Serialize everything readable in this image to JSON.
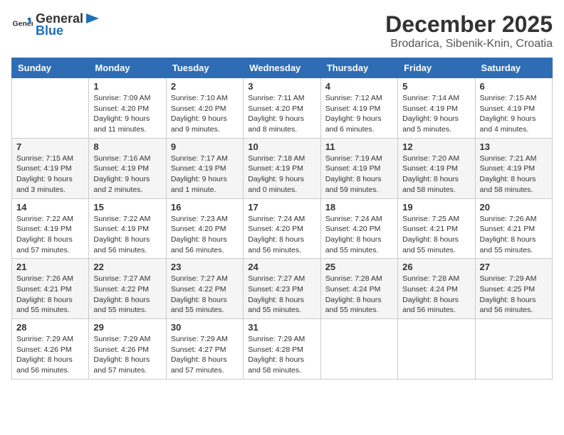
{
  "header": {
    "logo_general": "General",
    "logo_blue": "Blue",
    "month_title": "December 2025",
    "location": "Brodarica, Sibenik-Knin, Croatia"
  },
  "columns": [
    "Sunday",
    "Monday",
    "Tuesday",
    "Wednesday",
    "Thursday",
    "Friday",
    "Saturday"
  ],
  "weeks": [
    [
      {
        "day": "",
        "info": ""
      },
      {
        "day": "1",
        "info": "Sunrise: 7:09 AM\nSunset: 4:20 PM\nDaylight: 9 hours\nand 11 minutes."
      },
      {
        "day": "2",
        "info": "Sunrise: 7:10 AM\nSunset: 4:20 PM\nDaylight: 9 hours\nand 9 minutes."
      },
      {
        "day": "3",
        "info": "Sunrise: 7:11 AM\nSunset: 4:20 PM\nDaylight: 9 hours\nand 8 minutes."
      },
      {
        "day": "4",
        "info": "Sunrise: 7:12 AM\nSunset: 4:19 PM\nDaylight: 9 hours\nand 6 minutes."
      },
      {
        "day": "5",
        "info": "Sunrise: 7:14 AM\nSunset: 4:19 PM\nDaylight: 9 hours\nand 5 minutes."
      },
      {
        "day": "6",
        "info": "Sunrise: 7:15 AM\nSunset: 4:19 PM\nDaylight: 9 hours\nand 4 minutes."
      }
    ],
    [
      {
        "day": "7",
        "info": "Sunrise: 7:15 AM\nSunset: 4:19 PM\nDaylight: 9 hours\nand 3 minutes."
      },
      {
        "day": "8",
        "info": "Sunrise: 7:16 AM\nSunset: 4:19 PM\nDaylight: 9 hours\nand 2 minutes."
      },
      {
        "day": "9",
        "info": "Sunrise: 7:17 AM\nSunset: 4:19 PM\nDaylight: 9 hours\nand 1 minute."
      },
      {
        "day": "10",
        "info": "Sunrise: 7:18 AM\nSunset: 4:19 PM\nDaylight: 9 hours\nand 0 minutes."
      },
      {
        "day": "11",
        "info": "Sunrise: 7:19 AM\nSunset: 4:19 PM\nDaylight: 8 hours\nand 59 minutes."
      },
      {
        "day": "12",
        "info": "Sunrise: 7:20 AM\nSunset: 4:19 PM\nDaylight: 8 hours\nand 58 minutes."
      },
      {
        "day": "13",
        "info": "Sunrise: 7:21 AM\nSunset: 4:19 PM\nDaylight: 8 hours\nand 58 minutes."
      }
    ],
    [
      {
        "day": "14",
        "info": "Sunrise: 7:22 AM\nSunset: 4:19 PM\nDaylight: 8 hours\nand 57 minutes."
      },
      {
        "day": "15",
        "info": "Sunrise: 7:22 AM\nSunset: 4:19 PM\nDaylight: 8 hours\nand 56 minutes."
      },
      {
        "day": "16",
        "info": "Sunrise: 7:23 AM\nSunset: 4:20 PM\nDaylight: 8 hours\nand 56 minutes."
      },
      {
        "day": "17",
        "info": "Sunrise: 7:24 AM\nSunset: 4:20 PM\nDaylight: 8 hours\nand 56 minutes."
      },
      {
        "day": "18",
        "info": "Sunrise: 7:24 AM\nSunset: 4:20 PM\nDaylight: 8 hours\nand 55 minutes."
      },
      {
        "day": "19",
        "info": "Sunrise: 7:25 AM\nSunset: 4:21 PM\nDaylight: 8 hours\nand 55 minutes."
      },
      {
        "day": "20",
        "info": "Sunrise: 7:26 AM\nSunset: 4:21 PM\nDaylight: 8 hours\nand 55 minutes."
      }
    ],
    [
      {
        "day": "21",
        "info": "Sunrise: 7:26 AM\nSunset: 4:21 PM\nDaylight: 8 hours\nand 55 minutes."
      },
      {
        "day": "22",
        "info": "Sunrise: 7:27 AM\nSunset: 4:22 PM\nDaylight: 8 hours\nand 55 minutes."
      },
      {
        "day": "23",
        "info": "Sunrise: 7:27 AM\nSunset: 4:22 PM\nDaylight: 8 hours\nand 55 minutes."
      },
      {
        "day": "24",
        "info": "Sunrise: 7:27 AM\nSunset: 4:23 PM\nDaylight: 8 hours\nand 55 minutes."
      },
      {
        "day": "25",
        "info": "Sunrise: 7:28 AM\nSunset: 4:24 PM\nDaylight: 8 hours\nand 55 minutes."
      },
      {
        "day": "26",
        "info": "Sunrise: 7:28 AM\nSunset: 4:24 PM\nDaylight: 8 hours\nand 56 minutes."
      },
      {
        "day": "27",
        "info": "Sunrise: 7:29 AM\nSunset: 4:25 PM\nDaylight: 8 hours\nand 56 minutes."
      }
    ],
    [
      {
        "day": "28",
        "info": "Sunrise: 7:29 AM\nSunset: 4:26 PM\nDaylight: 8 hours\nand 56 minutes."
      },
      {
        "day": "29",
        "info": "Sunrise: 7:29 AM\nSunset: 4:26 PM\nDaylight: 8 hours\nand 57 minutes."
      },
      {
        "day": "30",
        "info": "Sunrise: 7:29 AM\nSunset: 4:27 PM\nDaylight: 8 hours\nand 57 minutes."
      },
      {
        "day": "31",
        "info": "Sunrise: 7:29 AM\nSunset: 4:28 PM\nDaylight: 8 hours\nand 58 minutes."
      },
      {
        "day": "",
        "info": ""
      },
      {
        "day": "",
        "info": ""
      },
      {
        "day": "",
        "info": ""
      }
    ]
  ]
}
